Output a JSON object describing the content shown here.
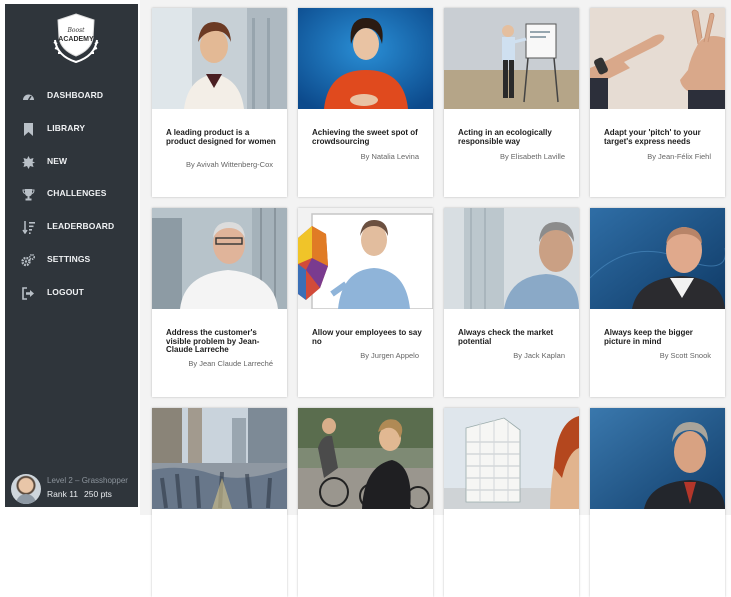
{
  "brand": {
    "logo_line1": "Boost",
    "logo_line2": "ACADEMY"
  },
  "nav": [
    {
      "label": "DASHBOARD",
      "icon": "dashboard-icon"
    },
    {
      "label": "LIBRARY",
      "icon": "bookmark-icon"
    },
    {
      "label": "NEW",
      "icon": "new-badge-icon"
    },
    {
      "label": "CHALLENGES",
      "icon": "trophy-icon"
    },
    {
      "label": "LEADERBOARD",
      "icon": "sort-icon"
    },
    {
      "label": "SETTINGS",
      "icon": "gears-icon"
    },
    {
      "label": "LOGOUT",
      "icon": "sign-out-icon"
    }
  ],
  "profile": {
    "level": "Level 2 – Grasshopper",
    "rank": "Rank 11",
    "points": "250 pts"
  },
  "cards": [
    {
      "title": "A leading product is a product designed for women",
      "author": "By Avivah Wittenberg-Cox"
    },
    {
      "title": "Achieving the sweet spot of crowdsourcing",
      "author": "By Natalia Levina"
    },
    {
      "title": "Acting in an ecologically responsible way",
      "author": "By Elisabeth Laville"
    },
    {
      "title": "Adapt your 'pitch' to your target's express needs",
      "author": "By Jean-Félix Fiehl"
    },
    {
      "title": "Address the customer's visible problem by Jean-Claude Larreche",
      "author": "By Jean Claude Larreché"
    },
    {
      "title": "Allow your employees to say no",
      "author": "By Jurgen Appelo"
    },
    {
      "title": "Always check the market potential",
      "author": "By Jack Kaplan"
    },
    {
      "title": "Always keep the bigger picture in mind",
      "author": "By Scott Snook"
    },
    {
      "title": "",
      "author": ""
    },
    {
      "title": "",
      "author": ""
    },
    {
      "title": "",
      "author": ""
    },
    {
      "title": "",
      "author": ""
    }
  ],
  "colors": {
    "sidebar": "#2f353b",
    "content_bg": "#f3f3f3"
  }
}
